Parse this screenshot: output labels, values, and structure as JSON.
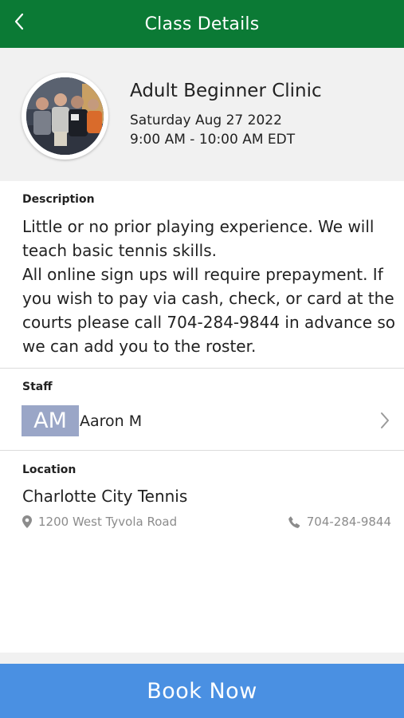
{
  "header": {
    "title": "Class Details",
    "back_icon": "chevron-left-icon"
  },
  "class_info": {
    "name": "Adult Beginner Clinic",
    "date": "Saturday Aug 27 2022",
    "time": "9:00 AM - 10:00 AM EDT"
  },
  "description": {
    "label": "Description",
    "lines": [
      "Little or no prior playing experience. We will",
      "teach basic tennis skills.",
      "All online sign ups will require prepayment. If",
      "you wish to pay via cash, check, or card at the",
      "courts please call 704-284-9844 in advance so",
      "we can add you to the roster."
    ]
  },
  "staff": {
    "label": "Staff",
    "initials": "AM",
    "name": "Aaron M",
    "initials_bg": "#9aa6c7"
  },
  "location": {
    "label": "Location",
    "name": "Charlotte City Tennis",
    "address": "1200 West Tyvola Road",
    "phone": "704-284-9844",
    "address_icon": "map-pin-icon",
    "phone_icon": "phone-icon"
  },
  "footer": {
    "book_label": "Book Now"
  },
  "colors": {
    "header_bg": "#0b7a35",
    "button_bg": "#4a90e2",
    "card_bg": "#f1f1f1"
  }
}
